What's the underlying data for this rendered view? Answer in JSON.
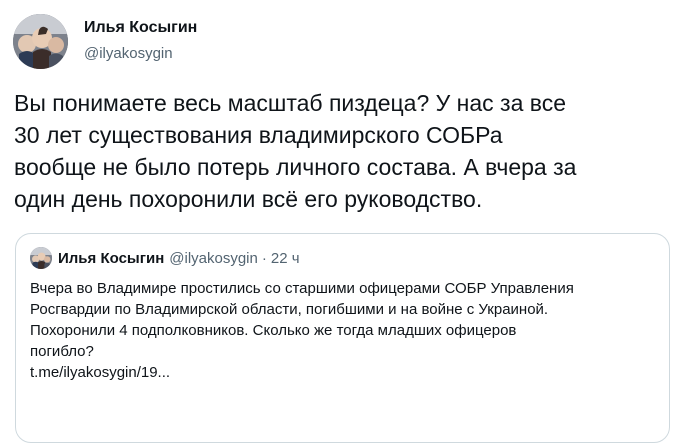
{
  "author": {
    "display_name": "Илья Косыгин",
    "handle": "@ilyakosygin"
  },
  "tweet": {
    "lines": [
      "Вы понимаете весь масштаб пиздеца? У нас за все",
      "30 лет существования владимирского СОБРа",
      "вообще не было потерь личного состава. А вчера за",
      "один день похоронили всё его руководство."
    ]
  },
  "quote": {
    "display_name": "Илья Косыгин",
    "handle": "@ilyakosygin",
    "separator": "·",
    "time": "22 ч",
    "lines": [
      "Вчера во Владимире простились со старшими офицерами СОБР Управления",
      "Росгвардии по Владимирской области, погибшими и на войне с Украиной.",
      "Похоронили 4 подполковников. Сколько же тогда младших офицеров",
      "погибло?",
      "t.me/ilyakosygin/19..."
    ]
  },
  "colors": {
    "text": "#0f1419",
    "secondary": "#536471",
    "border": "#cfd9de"
  }
}
